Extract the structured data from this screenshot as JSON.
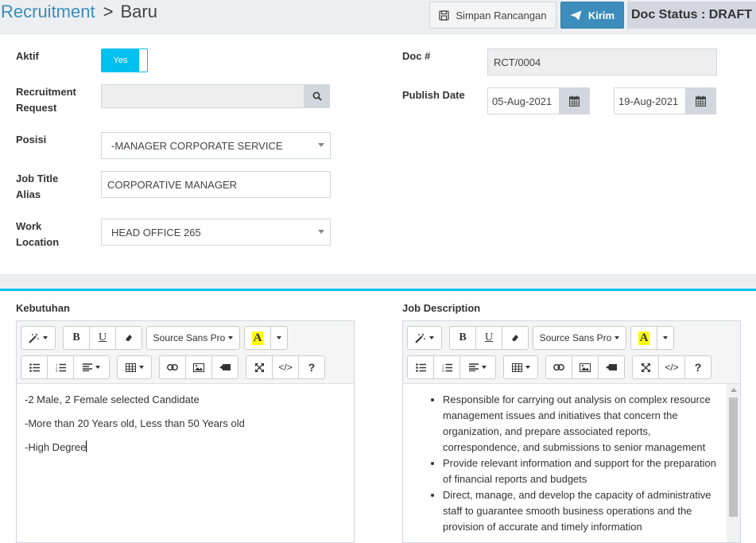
{
  "header": {
    "breadcrumb_parent": "Recruitment",
    "breadcrumb_sep": ">",
    "breadcrumb_current": "Baru",
    "draft_button": "Simpan Rancangan",
    "send_button": "Kirim",
    "doc_status": "Doc Status : DRAFT"
  },
  "form": {
    "aktif_label": "Aktif",
    "aktif_toggle": "Yes",
    "recruitment_request_label": "Recruitment Request",
    "recruitment_request_value": "",
    "posisi_label": "Posisi",
    "posisi_value": "-MANAGER CORPORATE SERVICE",
    "job_title_alias_label": "Job Title Alias",
    "job_title_alias_value": "CORPORATIVE MANAGER",
    "work_location_label": "Work Location",
    "work_location_value": "HEAD OFFICE 265",
    "doc_no_label": "Doc #",
    "doc_no_value": "RCT/0004",
    "publish_date_label": "Publish Date",
    "publish_date_from": "05-Aug-2021",
    "publish_date_to": "19-Aug-2021"
  },
  "editors": {
    "font_name": "Source Sans Pro",
    "kebutuhan": {
      "title": "Kebutuhan",
      "lines": [
        "-2 Male, 2 Female selected Candidate",
        "-More than 20 Years old, Less than 50 Years old",
        "-High Degree"
      ]
    },
    "job_description": {
      "title": "Job Description",
      "items": [
        "Responsible for carrying out analysis on complex resource management issues and initiatives that concern the organization, and prepare associated reports, correspondence, and submissions to senior management",
        "Provide relevant information and support for the preparation of financial reports and budgets",
        "Direct, manage, and develop the capacity of administrative staff to guarantee smooth business operations and the provision of accurate and timely information"
      ]
    }
  },
  "colors": {
    "accent": "#3c8dbc",
    "toggle_on": "#00c0ef",
    "status_bg": "#d2d6de",
    "highlight_yellow": "#ffff00"
  },
  "icons": [
    "save-icon",
    "paper-plane-icon",
    "search-icon",
    "calendar-icon",
    "magic-wand-icon",
    "bold-icon",
    "underline-icon",
    "eraser-icon",
    "font-color-icon",
    "bullet-list-icon",
    "numbered-list-icon",
    "align-icon",
    "table-icon",
    "link-icon",
    "image-icon",
    "video-icon",
    "fullscreen-icon",
    "code-view-icon",
    "help-icon"
  ]
}
